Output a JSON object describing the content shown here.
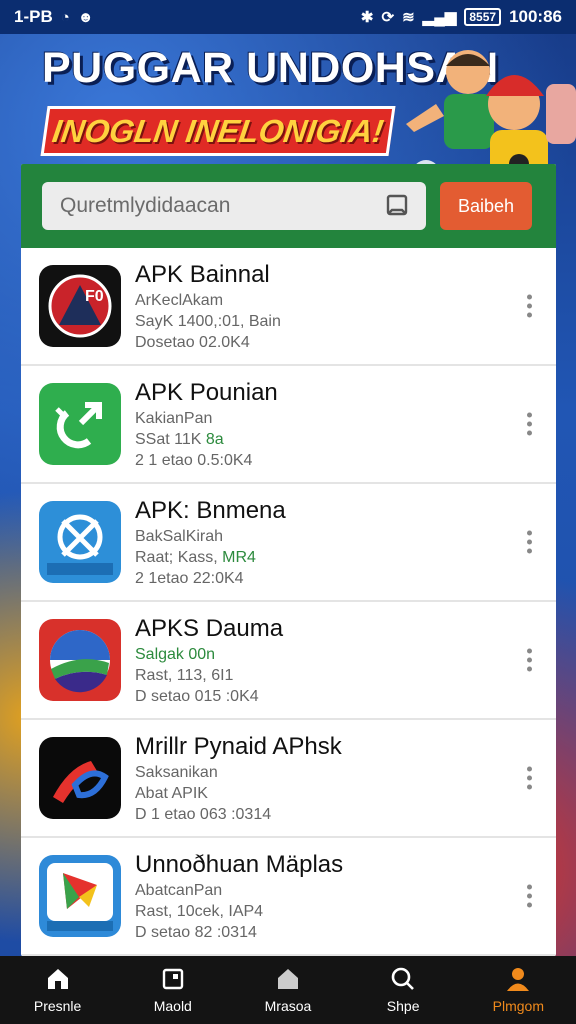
{
  "status_bar": {
    "left_text": "1-PB",
    "time": "100:86",
    "battery": "8557"
  },
  "banner": {
    "title": "PUGGAR UNDOHSAN",
    "subtitle": "INOGLN INELONIGIA!"
  },
  "search": {
    "placeholder": "Quretmlydidaacan",
    "button_label": "Baibeh"
  },
  "apps": [
    {
      "name": "APK Bainnal",
      "line1": "ArKeclAkam",
      "line2": "SayK 1400,:01, Bain",
      "line3": "Dosetao 02.0K4",
      "icon": "bainnal-app-icon"
    },
    {
      "name": "APK Pounian",
      "line1": "KakianPan",
      "line2": "SSat 11K",
      "line2_accent": "8a",
      "line3": "2 1 etao 0.5:0K4",
      "icon": "pounian-app-icon"
    },
    {
      "name": "APK: Bnmena",
      "line1": "BakSalKirah",
      "line2": "Raat; Kass,",
      "line2_accent": "MR4",
      "line3": "2 1etao 22:0K4",
      "icon": "bnmena-app-icon"
    },
    {
      "name": "APKS Dauma",
      "line1": "Salgak 00n",
      "line2": "Rast, 113, 6I1",
      "line3": "D setao 015 :0K4",
      "icon": "dauma-app-icon",
      "line1_green": true
    },
    {
      "name": "Mrillr Pynaid APhsk",
      "line1": "Saksanikan",
      "line2": "Abat APIK",
      "line3": "D 1 etao 063 :0314",
      "icon": "pynaid-app-icon"
    },
    {
      "name": "Unnoðhuan Mäplas",
      "line1": "AbatcanPan",
      "line2": "Rast, 10cek, IAP4",
      "line3": "D setao 82 :0314",
      "icon": "maplas-app-icon"
    }
  ],
  "bottom_nav": [
    {
      "label": "Presnle",
      "icon": "home-icon"
    },
    {
      "label": "Maold",
      "icon": "square-icon"
    },
    {
      "label": "Mrasoa",
      "icon": "house-icon"
    },
    {
      "label": "Shpe",
      "icon": "search-icon"
    },
    {
      "label": "Plmgom",
      "icon": "person-icon",
      "active": true
    }
  ],
  "colors": {
    "header_green": "#23843d",
    "accent_orange": "#e35c32",
    "nav_active": "#f08a1c"
  }
}
